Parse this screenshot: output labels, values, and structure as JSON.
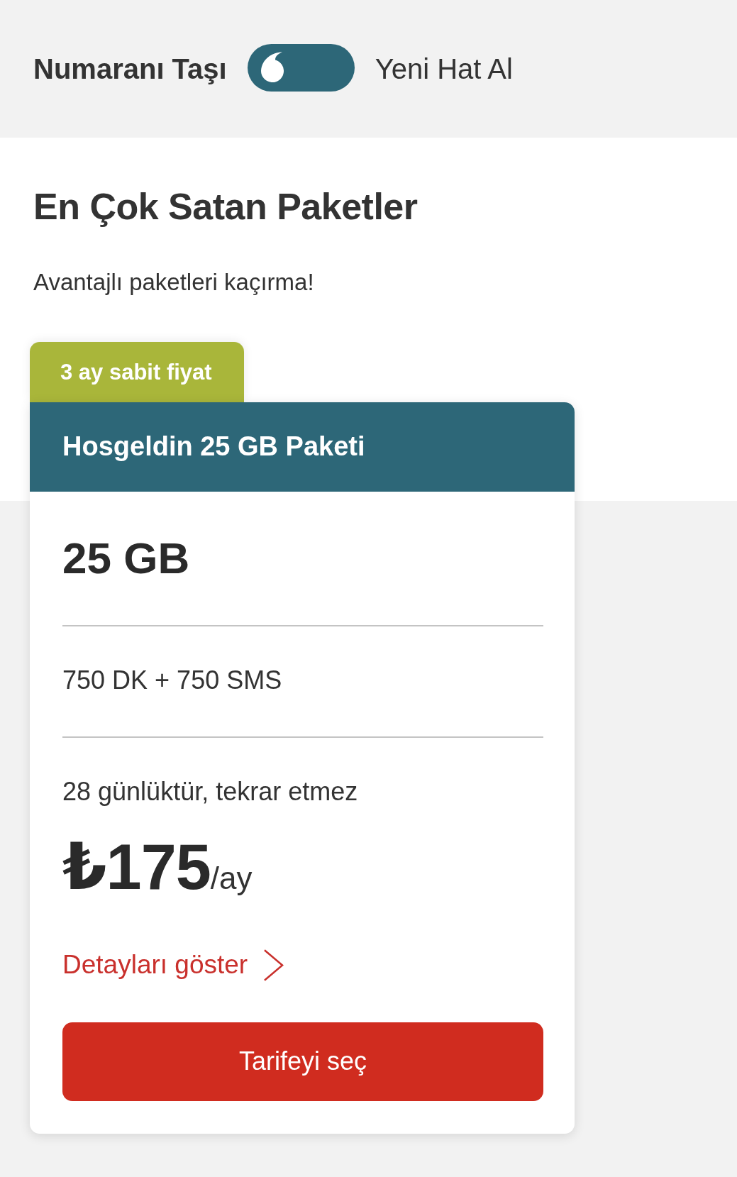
{
  "toggle": {
    "options": [
      {
        "label": "Numaranı Taşı",
        "selected": true
      },
      {
        "label": "Yeni Hat Al",
        "selected": false
      }
    ]
  },
  "section": {
    "title": "En Çok Satan Paketler",
    "subtitle": "Avantajlı paketleri kaçırma!"
  },
  "package": {
    "badge": "3 ay sabit fiyat",
    "name": "Hosgeldin 25 GB Paketi",
    "data": "25 GB",
    "allowance": "750 DK + 750 SMS",
    "validity": "28 günlüktür, tekrar etmez",
    "price": "₺175",
    "period": "/ay",
    "details_link": "Detayları göster",
    "button": "Tarifeyi seç"
  }
}
